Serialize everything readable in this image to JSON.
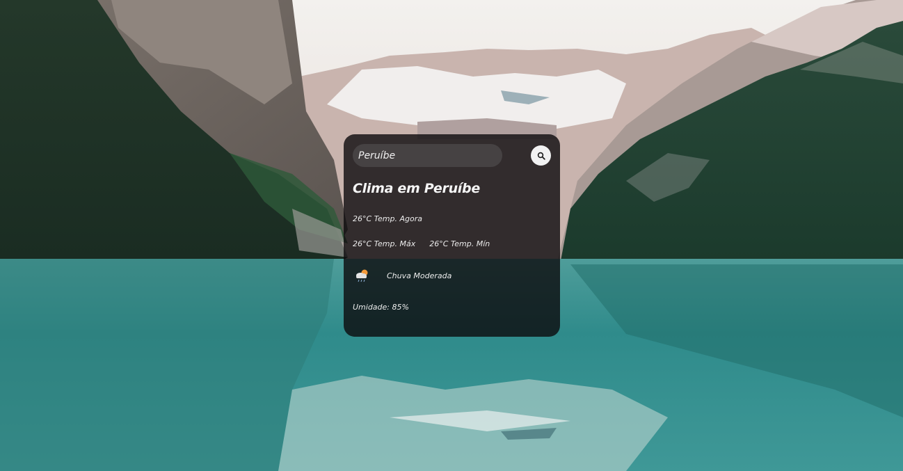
{
  "background": {
    "description_icon": "mountain-lake-photo-background",
    "sky_color": "#eae6e4",
    "water_color": "#2f8b8b",
    "forest_color": "#1f3a2c"
  },
  "search": {
    "value": "Peruíbe",
    "placeholder": "Peruíbe",
    "button_icon": "search-icon"
  },
  "weather": {
    "title": "Clima em Peruíbe",
    "temp_now": "26°C Temp. Agora",
    "temp_max": "26°C Temp. Máx",
    "temp_min": "26°C Temp. Mín",
    "icon": "rain-cloud-sun-icon",
    "description": "Chuva Moderada",
    "humidity": "Umidade: 85%"
  }
}
